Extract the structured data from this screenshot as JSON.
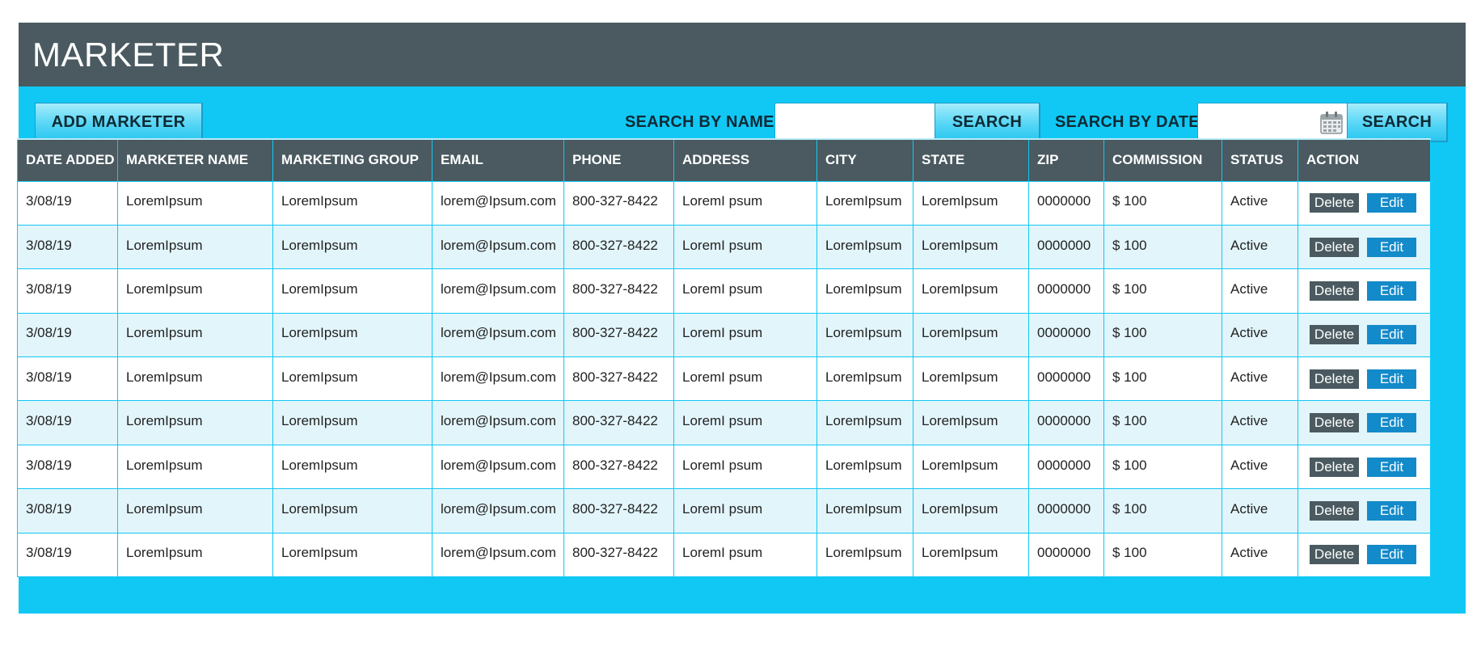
{
  "header": {
    "title": "MARKETER"
  },
  "toolbar": {
    "add_label": "ADD MARKETER",
    "search_name_label": "SEARCH BY NAME:",
    "search_name_value": "",
    "search_button_label": "SEARCH",
    "search_date_label": "SEARCH BY DATE:",
    "search_date_value": "",
    "search_date_button_label": "SEARCH"
  },
  "table": {
    "columns": [
      "DATE ADDED",
      "MARKETER NAME",
      "MARKETING GROUP",
      "EMAIL",
      "PHONE",
      "ADDRESS",
      "CITY",
      "STATE",
      "ZIP",
      "COMMISSION",
      "STATUS",
      "ACTION"
    ],
    "delete_label": "Delete",
    "edit_label": "Edit",
    "rows": [
      [
        "3/08/19",
        "LoremIpsum",
        "LoremIpsum",
        "lorem@Ipsum.com",
        "800-327-8422",
        "LoremI psum",
        "LoremIpsum",
        "LoremIpsum",
        "0000000",
        "$ 100",
        "Active"
      ],
      [
        "3/08/19",
        "LoremIpsum",
        "LoremIpsum",
        "lorem@Ipsum.com",
        "800-327-8422",
        "LoremI psum",
        "LoremIpsum",
        "LoremIpsum",
        "0000000",
        "$ 100",
        "Active"
      ],
      [
        "3/08/19",
        "LoremIpsum",
        "LoremIpsum",
        "lorem@Ipsum.com",
        "800-327-8422",
        "LoremI psum",
        "LoremIpsum",
        "LoremIpsum",
        "0000000",
        "$ 100",
        "Active"
      ],
      [
        "3/08/19",
        "LoremIpsum",
        "LoremIpsum",
        "lorem@Ipsum.com",
        "800-327-8422",
        "LoremI psum",
        "LoremIpsum",
        "LoremIpsum",
        "0000000",
        "$ 100",
        "Active"
      ],
      [
        "3/08/19",
        "LoremIpsum",
        "LoremIpsum",
        "lorem@Ipsum.com",
        "800-327-8422",
        "LoremI psum",
        "LoremIpsum",
        "LoremIpsum",
        "0000000",
        "$ 100",
        "Active"
      ],
      [
        "3/08/19",
        "LoremIpsum",
        "LoremIpsum",
        "lorem@Ipsum.com",
        "800-327-8422",
        "LoremI psum",
        "LoremIpsum",
        "LoremIpsum",
        "0000000",
        "$ 100",
        "Active"
      ],
      [
        "3/08/19",
        "LoremIpsum",
        "LoremIpsum",
        "lorem@Ipsum.com",
        "800-327-8422",
        "LoremI psum",
        "LoremIpsum",
        "LoremIpsum",
        "0000000",
        "$ 100",
        "Active"
      ],
      [
        "3/08/19",
        "LoremIpsum",
        "LoremIpsum",
        "lorem@Ipsum.com",
        "800-327-8422",
        "LoremI psum",
        "LoremIpsum",
        "LoremIpsum",
        "0000000",
        "$ 100",
        "Active"
      ],
      [
        "3/08/19",
        "LoremIpsum",
        "LoremIpsum",
        "lorem@Ipsum.com",
        "800-327-8422",
        "LoremI psum",
        "LoremIpsum",
        "LoremIpsum",
        "0000000",
        "$ 100",
        "Active"
      ]
    ]
  },
  "colors": {
    "frame": "#11c8f5",
    "header": "#4a5a60",
    "row_alt": "#e2f5fb",
    "delete_button": "#4a5a60",
    "edit_button": "#138ac9"
  },
  "icons": {
    "date_picker": "calendar-icon"
  }
}
